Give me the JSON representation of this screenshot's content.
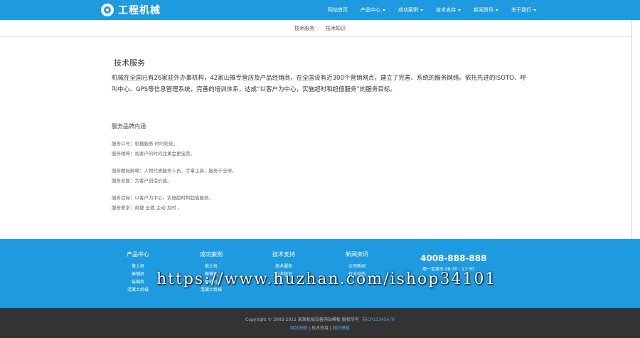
{
  "header": {
    "logo_text": "工程机械",
    "nav": [
      {
        "label": "网站首页",
        "dropdown": false
      },
      {
        "label": "产品中心",
        "dropdown": true
      },
      {
        "label": "成功案例",
        "dropdown": true
      },
      {
        "label": "技术支持",
        "dropdown": true
      },
      {
        "label": "新闻资讯",
        "dropdown": true
      },
      {
        "label": "关于我们",
        "dropdown": true
      }
    ]
  },
  "subnav": [
    "技术服务",
    "技术知识"
  ],
  "main": {
    "title": "技术服务",
    "intro": "机械在全国已有26家驻外办事机构，42家山推专营店及产品经销商，在全国设有近300个营销网点，建立了完善、系统的服务网络。依托先进的ISOTO、呼叫中心、GPS等信息管理系统，完善的培训体系，达成“以客户为中心，实施超时和超值服务”的服务目标。",
    "section_title": "服务品牌内涵",
    "items": [
      "服务口号：机械服务 时时处处。",
      "服务精神：视客户的时间比黄金更宝贵。",
      "服务图标解释：人物代表服务人员，手拿工具，服务于全球。",
      "服务总督：为客户创造价值。",
      "服务目标：以客户为中心，实施超时和超值服务。",
      "服务要求：周捷 全面 主动 及时 。"
    ]
  },
  "footer": {
    "columns": [
      {
        "title": "产品中心",
        "links": [
          "推土机",
          "摊铺机",
          "装载机",
          "混凝土机械"
        ]
      },
      {
        "title": "成功案例",
        "links": [
          "推土机",
          "摊铺机",
          "摊铺机",
          "混凝土机械"
        ]
      },
      {
        "title": "技术支持",
        "links": [
          "技术服务",
          "技术知识"
        ]
      },
      {
        "title": "新闻资讯",
        "links": [
          "公司新闻",
          "行业动态"
        ]
      }
    ],
    "hotline": "4008-888-888",
    "hours": "周一至周五 08:30 - 17:30",
    "watermark": "https://www.huzhan.com/ishop34101"
  },
  "bottom": {
    "copyright": "Copyright © 2002-2011 某某机械设备网站模板 版权所有",
    "icp": "苏ICP12345678",
    "links": [
      "网站地图",
      "技术支持",
      "网站模板"
    ],
    "sep": "|"
  },
  "colors": {
    "primary": "#1e9ae0",
    "dark": "#333333"
  }
}
